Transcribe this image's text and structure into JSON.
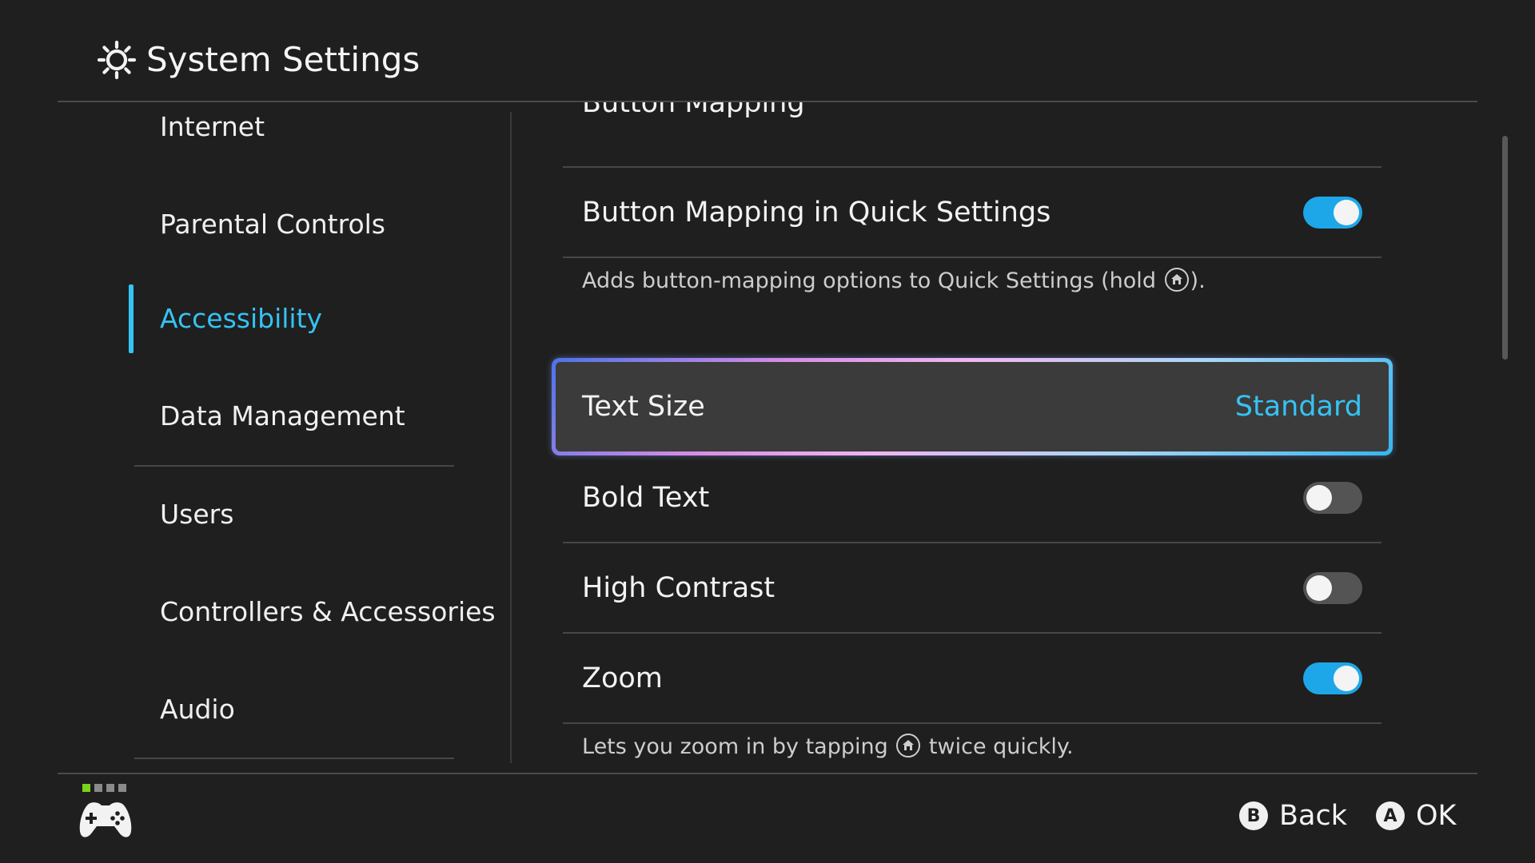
{
  "header": {
    "title": "System Settings",
    "icon": "gear-icon"
  },
  "sidebar": {
    "items": [
      {
        "label": "Internet",
        "active": false
      },
      {
        "label": "Parental Controls",
        "active": false
      },
      {
        "label": "Accessibility",
        "active": true
      },
      {
        "label": "Data Management",
        "active": false
      },
      {
        "label": "Users",
        "active": false
      },
      {
        "label": "Controllers & Accessories",
        "active": false
      },
      {
        "label": "Audio",
        "active": false
      }
    ]
  },
  "content": {
    "button_mapping": {
      "label": "Button Mapping"
    },
    "button_mapping_quick": {
      "label": "Button Mapping in Quick Settings",
      "enabled": true,
      "description_before": "Adds button-mapping options to Quick Settings (hold ",
      "description_after": ")."
    },
    "text_size": {
      "label": "Text Size",
      "value": "Standard"
    },
    "bold_text": {
      "label": "Bold Text",
      "enabled": false
    },
    "high_contrast": {
      "label": "High Contrast",
      "enabled": false
    },
    "zoom": {
      "label": "Zoom",
      "enabled": true,
      "description_before": "Lets you zoom in by tapping ",
      "description_after": " twice quickly."
    }
  },
  "footer": {
    "back": {
      "glyph": "B",
      "label": "Back"
    },
    "ok": {
      "glyph": "A",
      "label": "OK"
    },
    "controller_icon": "gamepad-icon"
  },
  "colors": {
    "background": "#1f1f1f",
    "accent": "#35c3f3",
    "toggle_on": "#1ea7e8",
    "toggle_off": "#545454",
    "player_indicator_active": "#7ad31c"
  }
}
